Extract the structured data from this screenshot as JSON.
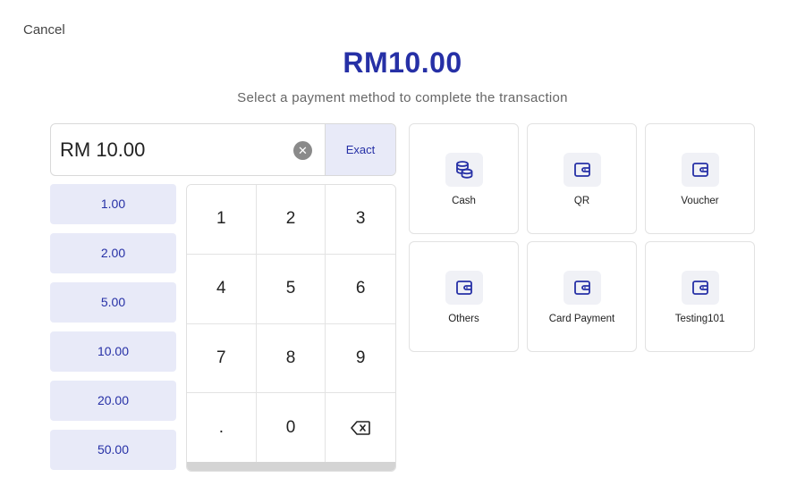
{
  "header": {
    "cancel_label": "Cancel",
    "total": "RM10.00",
    "subtitle": "Select a payment method to complete the transaction"
  },
  "amount_input": {
    "value": "RM 10.00",
    "clear_icon": "clear-circle-icon",
    "exact_label": "Exact"
  },
  "quick_amounts": [
    "1.00",
    "2.00",
    "5.00",
    "10.00",
    "20.00",
    "50.00"
  ],
  "keypad": {
    "keys": [
      "1",
      "2",
      "3",
      "4",
      "5",
      "6",
      "7",
      "8",
      "9",
      ".",
      "0",
      "backspace-icon"
    ]
  },
  "payment_methods": [
    {
      "label": "Cash",
      "icon": "coins-icon"
    },
    {
      "label": "QR",
      "icon": "wallet-icon"
    },
    {
      "label": "Voucher",
      "icon": "wallet-icon"
    },
    {
      "label": "Others",
      "icon": "wallet-icon"
    },
    {
      "label": "Card Payment",
      "icon": "wallet-icon"
    },
    {
      "label": "Testing101",
      "icon": "wallet-icon"
    }
  ],
  "colors": {
    "accent": "#2630a6",
    "quick_bg": "#e8eaf8",
    "icon_bg": "#f0f1f6"
  }
}
